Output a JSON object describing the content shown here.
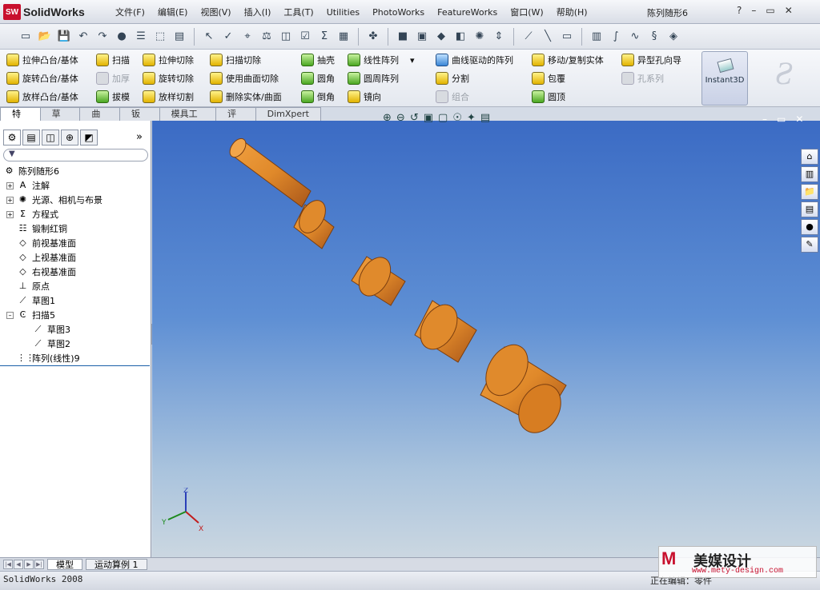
{
  "app": {
    "name": "SolidWorks",
    "logo_mark": "SW",
    "doc_title": "陈列随形6"
  },
  "menu": [
    "文件(F)",
    "编辑(E)",
    "视图(V)",
    "插入(I)",
    "工具(T)",
    "Utilities",
    "PhotoWorks",
    "FeatureWorks",
    "窗口(W)",
    "帮助(H)"
  ],
  "window_controls": {
    "help": "?",
    "minimize": "–",
    "restore": "▭",
    "close": "✕"
  },
  "std_toolbar": [
    "new",
    "open",
    "save",
    "undo",
    "redo",
    "rebuild",
    "options",
    "select",
    "spell",
    "measure",
    "balance",
    "check",
    "sum",
    "mass",
    "view-orient",
    "cube-front",
    "cube-shaded",
    "cube-iso",
    "section",
    "lights",
    "axis",
    "sketch-line",
    "sketch-rect",
    "cylinder",
    "spline",
    "curve",
    "diamond"
  ],
  "commands": {
    "col1": [
      "拉伸凸台/基体",
      "旋转凸台/基体",
      "放样凸台/基体"
    ],
    "col2": [
      "扫描",
      "加厚",
      "拔模"
    ],
    "col3": [
      "拉伸切除",
      "旋转切除",
      "放样切割"
    ],
    "col4": [
      "扫描切除",
      "使用曲面切除",
      "删除实体/曲面"
    ],
    "col5": [
      "抽壳",
      "圆角",
      "倒角"
    ],
    "col6": [
      "线性阵列",
      "圆周阵列",
      "镜向"
    ],
    "col7": [
      "曲线驱动的阵列",
      "分割",
      "组合"
    ],
    "col8": [
      "移动/复制实体",
      "包覆",
      "圆顶"
    ],
    "col9": [
      "异型孔向导",
      "孔系列"
    ],
    "instant3d": "Instant3D",
    "dropdown_arrow": "▾"
  },
  "tabs": [
    "特征",
    "草图",
    "曲面",
    "钣金",
    "模具工具",
    "评估",
    "DimXpert"
  ],
  "panel_tabs": [
    "feature-manager",
    "property-manager",
    "configuration-manager",
    "dim-manager",
    "display-manager"
  ],
  "panel_more": "»",
  "filter_icon": "▼",
  "tree": [
    {
      "label": "陈列随形6",
      "level": 0,
      "icon": "part-icon",
      "exp": ""
    },
    {
      "label": "注解",
      "level": 1,
      "icon": "annotation-icon",
      "exp": "+"
    },
    {
      "label": "光源、相机与布景",
      "level": 1,
      "icon": "lights-icon",
      "exp": "+"
    },
    {
      "label": "方程式",
      "level": 1,
      "icon": "equation-icon",
      "exp": "+"
    },
    {
      "label": "锻制红铜",
      "level": 1,
      "icon": "material-icon",
      "exp": ""
    },
    {
      "label": "前视基准面",
      "level": 1,
      "icon": "plane-icon",
      "exp": ""
    },
    {
      "label": "上视基准面",
      "level": 1,
      "icon": "plane-icon",
      "exp": ""
    },
    {
      "label": "右视基准面",
      "level": 1,
      "icon": "plane-icon",
      "exp": ""
    },
    {
      "label": "原点",
      "level": 1,
      "icon": "origin-icon",
      "exp": ""
    },
    {
      "label": "草图1",
      "level": 1,
      "icon": "sketch-icon",
      "exp": ""
    },
    {
      "label": "扫描5",
      "level": 1,
      "icon": "sweep-icon",
      "exp": "–"
    },
    {
      "label": "草图3",
      "level": 2,
      "icon": "sketch-icon",
      "exp": ""
    },
    {
      "label": "草图2",
      "level": 2,
      "icon": "sketch-icon",
      "exp": ""
    },
    {
      "label": "阵列(线性)9",
      "level": 1,
      "icon": "pattern-icon",
      "exp": ""
    }
  ],
  "splitter_glyph": "‹",
  "view_hud_glyphs": [
    "⊕",
    "⊖",
    "↺",
    "▣",
    "▢",
    "☉",
    "✦",
    "▤"
  ],
  "triad": {
    "x": "X",
    "y": "Y",
    "z": "Z"
  },
  "bottom_tabs": {
    "nav": [
      "|◀",
      "◀",
      "▶",
      "▶|"
    ],
    "model": "模型",
    "motion": "运动算例 1"
  },
  "status": {
    "left": "SolidWorks 2008",
    "right": "正在编辑：零件"
  },
  "watermark": {
    "logo": "M",
    "text": "美媒设计",
    "url": "www.mety-design.com"
  },
  "colors": {
    "viewport_top": "#3b6bc4",
    "part": "#e0892a",
    "accent": "#c8102e"
  }
}
